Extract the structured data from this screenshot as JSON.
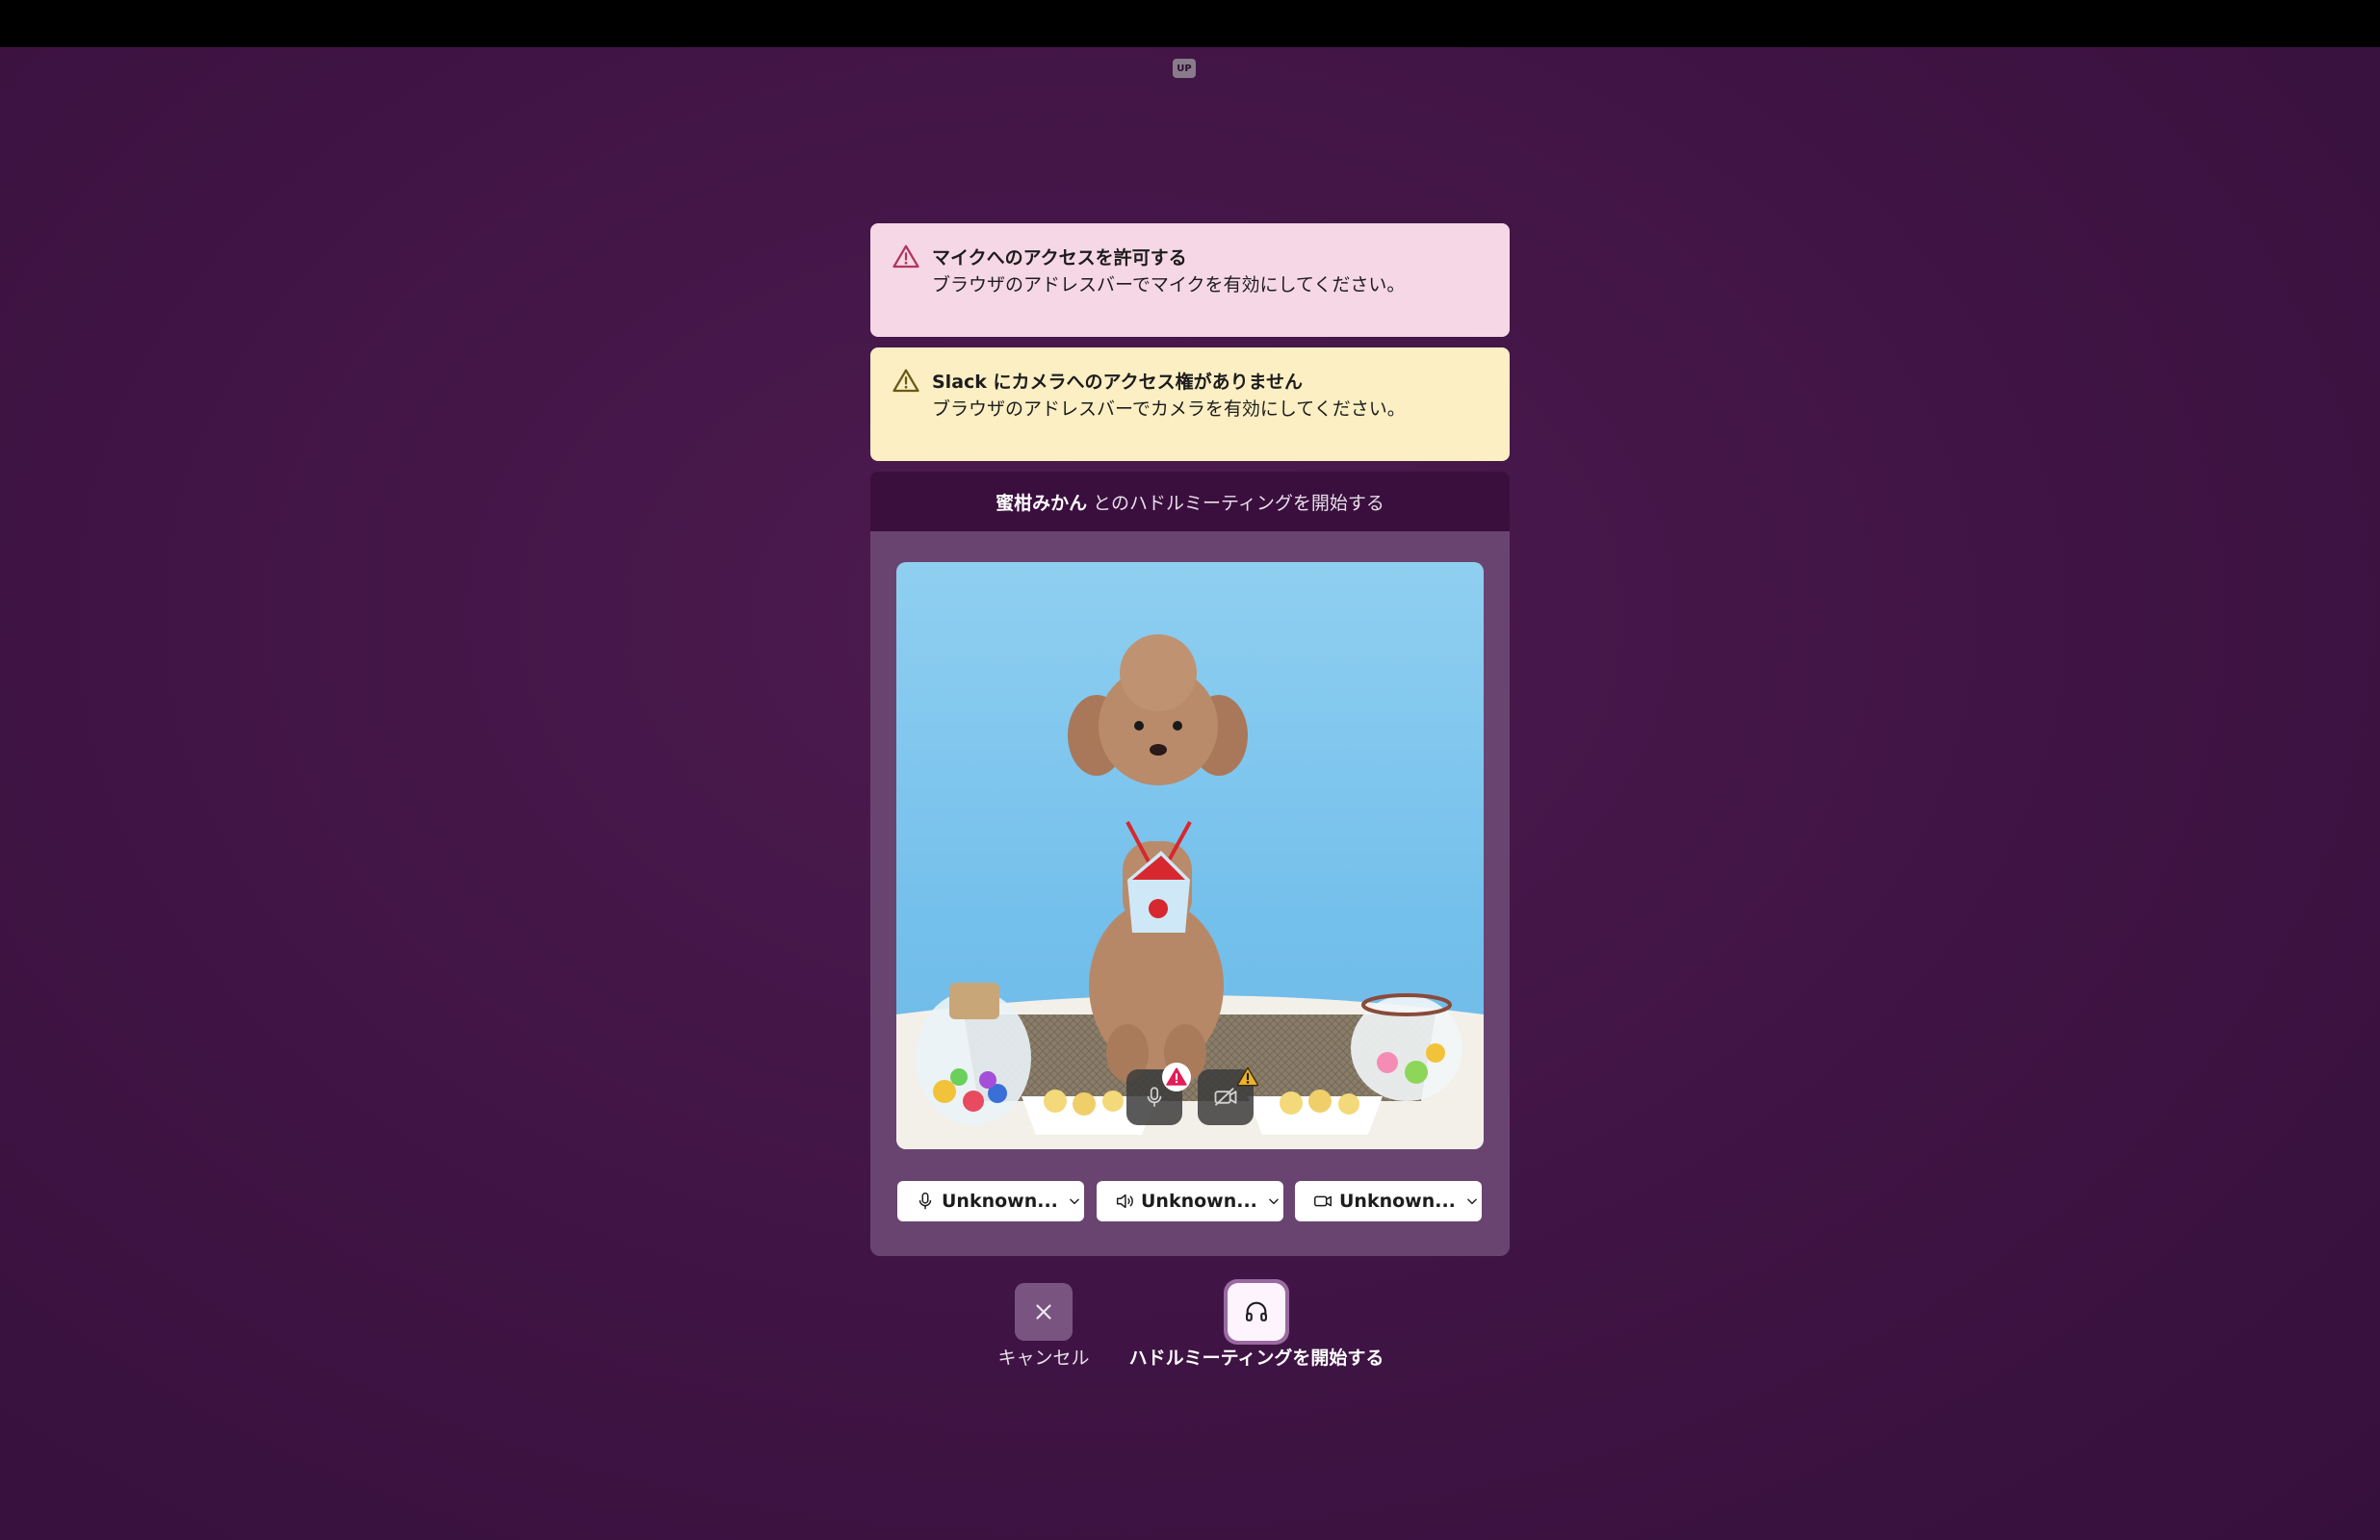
{
  "top_badge": "UP",
  "alerts": {
    "mic": {
      "title": "マイクへのアクセスを許可する",
      "body": "ブラウザのアドレスバーでマイクを有効にしてください。",
      "icon": "warning-triangle-icon",
      "color": "#f6d7e5"
    },
    "camera": {
      "title": "Slack にカメラへのアクセス権がありません",
      "body": "ブラウザのアドレスバーでカメラを有効にしてください。",
      "icon": "warning-triangle-icon",
      "color": "#fbefc3"
    }
  },
  "huddle": {
    "name": "蜜柑みかん",
    "suffix": "とのハドルミーティングを開始する"
  },
  "video": {
    "image": "poodle-photo",
    "mic_button_icon": "mic-off-icon",
    "camera_button_icon": "camera-off-icon"
  },
  "devices": {
    "mic": {
      "label": "Unknown...",
      "icon": "mic-icon"
    },
    "speaker": {
      "label": "Unknown...",
      "icon": "speaker-icon"
    },
    "camera": {
      "label": "Unknown...",
      "icon": "video-camera-icon"
    }
  },
  "actions": {
    "cancel_label": "キャンセル",
    "start_label": "ハドルミーティングを開始する"
  },
  "colors": {
    "background": "#3f1444",
    "panel": "#6a4470",
    "warning_red": "#e01e5a",
    "warning_yellow": "#ecb22e"
  }
}
